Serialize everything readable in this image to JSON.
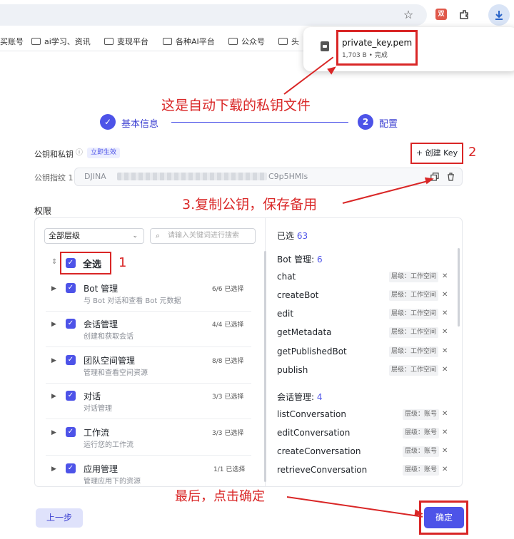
{
  "browser": {
    "star_icon": "star-icon",
    "extension_icon": "puzzle-icon",
    "download_icon": "download-icon",
    "ext_label": "双CA"
  },
  "bookmarks": [
    {
      "label": "买账号"
    },
    {
      "label": "ai学习、资讯"
    },
    {
      "label": "变现平台"
    },
    {
      "label": "各种AI平台"
    },
    {
      "label": "公众号"
    },
    {
      "label": "头"
    }
  ],
  "download": {
    "filename": "private_key.pem",
    "meta": "1,703 B • 完成"
  },
  "annotations": {
    "downloaded_file": "这是自动下载的私钥文件",
    "copy_public_key": "3.复制公钥，保存备用",
    "final_click": "最后，点击确定",
    "num_1": "1",
    "num_2": "2"
  },
  "steps": [
    {
      "icon": "✓",
      "label": "基本信息"
    },
    {
      "icon": "2",
      "label": "配置"
    }
  ],
  "keys": {
    "label": "公钥和私钥",
    "badge": "立即生效",
    "create_key": "+ 创建 Key",
    "fingerprint_label": "公钥指纹 1",
    "fingerprint_start": "DJINA",
    "fingerprint_end": "C9p5HMls"
  },
  "permissions": {
    "title": "权限",
    "level_select": "全部层级",
    "search_placeholder": "请输入关键词进行搜索",
    "select_all": "全选",
    "groups": [
      {
        "name": "Bot 管理",
        "desc": "与 Bot 对话和查看 Bot 元数据",
        "count": "6/6 已选择"
      },
      {
        "name": "会话管理",
        "desc": "创建和获取会话",
        "count": "4/4 已选择"
      },
      {
        "name": "团队空间管理",
        "desc": "管理和查看空间资源",
        "count": "8/8 已选择"
      },
      {
        "name": "对话",
        "desc": "对话管理",
        "count": "3/3 已选择"
      },
      {
        "name": "工作流",
        "desc": "运行您的工作流",
        "count": "3/3 已选择"
      },
      {
        "name": "应用管理",
        "desc": "管理应用下的资源",
        "count": "1/1 已选择"
      }
    ],
    "selected_label": "已选",
    "selected_count": "63",
    "bot_section": "Bot 管理:",
    "bot_count": "6",
    "bot_items": [
      "chat",
      "createBot",
      "edit",
      "getMetadata",
      "getPublishedBot",
      "publish"
    ],
    "bot_tag": "层级：工作空间",
    "conv_section": "会话管理:",
    "conv_count": "4",
    "conv_items": [
      "listConversation",
      "editConversation",
      "createConversation",
      "retrieveConversation"
    ],
    "conv_tag": "层级：账号"
  },
  "footer": {
    "prev": "上一步",
    "ok": "确定"
  }
}
